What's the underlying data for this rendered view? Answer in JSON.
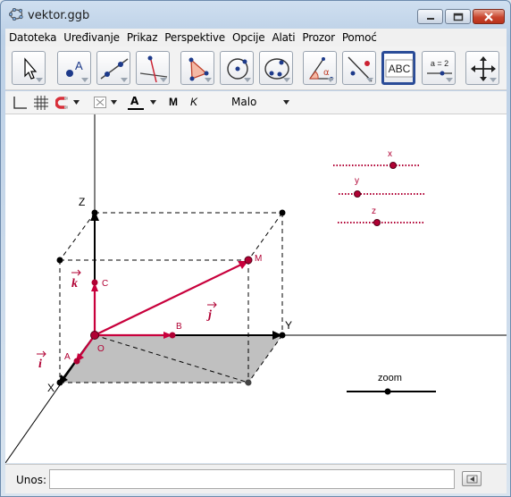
{
  "window": {
    "title": "vektor.ggb"
  },
  "menu": [
    "Datoteka",
    "Uređivanje",
    "Prikaz",
    "Perspektive",
    "Opcije",
    "Alati",
    "Prozor",
    "Pomoć"
  ],
  "toolbar": {
    "tools": [
      {
        "name": "move-tool",
        "icon": "arrow-pointer-icon"
      },
      {
        "name": "point-tool",
        "icon": "point-a-icon"
      },
      {
        "name": "line-tool",
        "icon": "line-through-points-icon"
      },
      {
        "name": "perpendicular-tool",
        "icon": "perpendicular-line-icon"
      },
      {
        "name": "polygon-tool",
        "icon": "polygon-icon"
      },
      {
        "name": "circle-tool",
        "icon": "circle-center-icon"
      },
      {
        "name": "conic-tool",
        "icon": "conic-points-icon"
      },
      {
        "name": "angle-tool",
        "icon": "angle-alpha-icon"
      },
      {
        "name": "reflect-tool",
        "icon": "reflect-line-icon"
      },
      {
        "name": "text-tool",
        "icon": "text-abc-icon",
        "label": "ABC",
        "active": true
      },
      {
        "name": "slider-tool",
        "icon": "slider-icon",
        "label": "a = 2"
      },
      {
        "name": "move-view-tool",
        "icon": "move-graphics-view-icon"
      }
    ],
    "text_tool_label": "ABC",
    "slider_tool_label": "a = 2"
  },
  "stylebar": {
    "bold_label": "M",
    "italic_label": "K",
    "font_size": "Malo",
    "text_color_label": "A"
  },
  "graphics": {
    "axis_labels": {
      "x": "X",
      "y": "Y",
      "z": "Z"
    },
    "points": {
      "o": "O",
      "a": "A",
      "b": "B",
      "c": "C",
      "m": "M"
    },
    "vector_labels": {
      "i": "i",
      "j": "j",
      "k": "k"
    },
    "sliders": {
      "x": "x",
      "y": "y",
      "z": "z",
      "zoom": "zoom"
    },
    "colors": {
      "vector": "#c8003c",
      "point_dark": "#000000",
      "point_red": "#b00033",
      "shade": "#c0c0c0"
    }
  },
  "input": {
    "label": "Unos:",
    "value": ""
  }
}
